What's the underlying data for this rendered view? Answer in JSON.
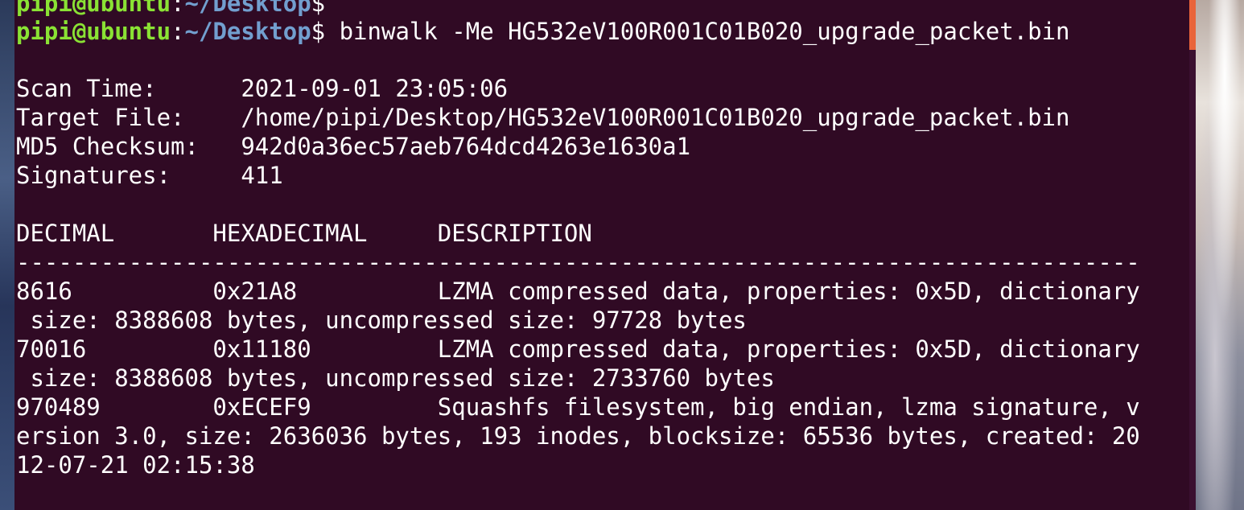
{
  "terminal": {
    "prompt_user": "pipi@ubuntu",
    "prompt_sep": ":",
    "prompt_path": "~/Desktop",
    "prompt_symbol": "$",
    "command": " binwalk -Me HG532eV100R001C01B020_upgrade_packet.bin",
    "info": [
      "Scan Time:      2021-09-01 23:05:06",
      "Target File:    /home/pipi/Desktop/HG532eV100R001C01B020_upgrade_packet.bin",
      "MD5 Checksum:   942d0a36ec57aeb764dcd4263e1630a1",
      "Signatures:     411"
    ],
    "table_header": "DECIMAL       HEXADECIMAL     DESCRIPTION",
    "separator": "--------------------------------------------------------------------------------",
    "output_lines": [
      "8616          0x21A8          LZMA compressed data, properties: 0x5D, dictionary",
      " size: 8388608 bytes, uncompressed size: 97728 bytes",
      "70016         0x11180         LZMA compressed data, properties: 0x5D, dictionary",
      " size: 8388608 bytes, uncompressed size: 2733760 bytes",
      "970489        0xECEF9         Squashfs filesystem, big endian, lzma signature, v",
      "ersion 3.0, size: 2636036 bytes, 193 inodes, blocksize: 65536 bytes, created: 20",
      "12-07-21 02:15:38"
    ]
  },
  "colors": {
    "background": "#300a24",
    "prompt_user": "#8ae234",
    "prompt_path": "#729fcf",
    "scroll_thumb": "#e9643a"
  }
}
